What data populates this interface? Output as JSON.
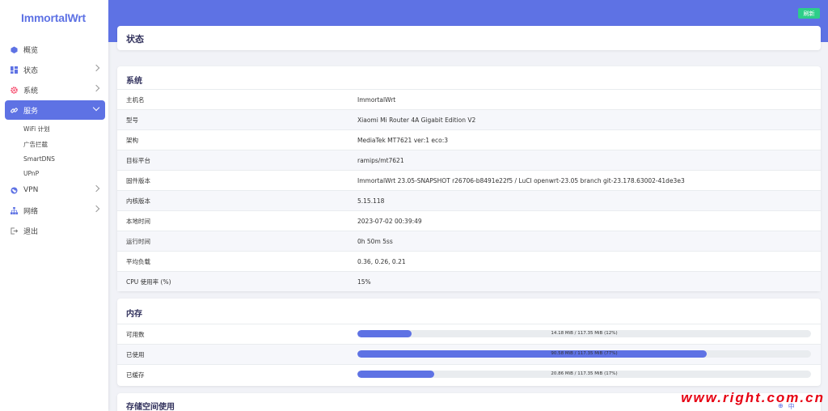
{
  "brand": "ImmortalWrt",
  "nav": {
    "overview": "概览",
    "status": "状态",
    "system": "系统",
    "services": "服务",
    "sub": [
      "WiFi 计划",
      "广告拦截",
      "SmartDNS",
      "UPnP"
    ],
    "vpn": "VPN",
    "network": "网络",
    "logout": "退出"
  },
  "header": {
    "refresh": "刷新"
  },
  "page_title": "状态",
  "system": {
    "title": "系统",
    "rows": [
      {
        "k": "主机名",
        "v": "ImmortalWrt"
      },
      {
        "k": "型号",
        "v": "Xiaomi Mi Router 4A Gigabit Edition V2"
      },
      {
        "k": "架构",
        "v": "MediaTek MT7621 ver:1 eco:3"
      },
      {
        "k": "目标平台",
        "v": "ramips/mt7621"
      },
      {
        "k": "固件版本",
        "v": "ImmortalWrt 23.05-SNAPSHOT r26706-b8491e22f5 / LuCI openwrt-23.05 branch git-23.178.63002-41de3e3"
      },
      {
        "k": "内核版本",
        "v": "5.15.118"
      },
      {
        "k": "本地时间",
        "v": "2023-07-02 00:39:49"
      },
      {
        "k": "运行时间",
        "v": "0h 50m 5ss"
      },
      {
        "k": "平均负载",
        "v": "0.36, 0.26, 0.21"
      },
      {
        "k": "CPU 使用率 (%)",
        "v": "15%"
      }
    ]
  },
  "memory": {
    "title": "内存",
    "rows": [
      {
        "k": "可用数",
        "label": "14.18 MiB / 117.35 MiB (12%)",
        "percent": 12
      },
      {
        "k": "已使用",
        "label": "90.58 MiB / 117.35 MiB (77%)",
        "percent": 77
      },
      {
        "k": "已缓存",
        "label": "20.86 MiB / 117.35 MiB (17%)",
        "percent": 17
      }
    ]
  },
  "storage": {
    "title": "存储空间使用"
  },
  "watermark": "www.right.com.cn",
  "tray": [
    "⊕",
    "中"
  ],
  "colors": {
    "accent": "#5e72e4",
    "refresh": "#2dce89",
    "watermark": "#e60012"
  }
}
